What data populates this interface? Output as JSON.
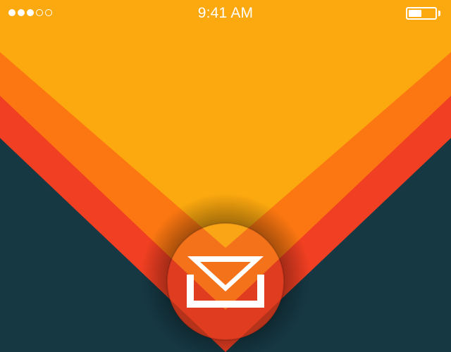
{
  "status_bar": {
    "time": "9:41 AM",
    "signal_bars_filled": 3,
    "signal_bars_total": 5,
    "battery_level": 0.5
  },
  "colors": {
    "background_teal": "#163843",
    "amber": "#fca80f",
    "orange": "#fc7711",
    "red": "#f03f22",
    "status_text": "#ffffff"
  },
  "icons": {
    "app_logo": "envelope-icon"
  }
}
